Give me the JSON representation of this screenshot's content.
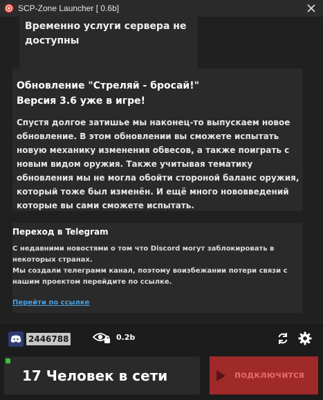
{
  "window": {
    "title": "SCP-Zone Launcher [ 0.6b]"
  },
  "news": [
    {
      "body": "Временно услуги сервера не доступны"
    },
    {
      "heading_line1": "Обновление \"Стреляй - бросай!\"",
      "heading_line2": "Версия 3.6 уже в игре!",
      "body": "Спустя долгое затишье мы наконец-то выпускаем новое обновление. В этом обновлении вы сможете испытать новую механику изменения обвесов, а также поиграть с новым видом оружия. Также учитывая тематику обновления мы не могла обойти стороной баланс оружия, который тоже был изменён. И ещё много нововведений которые вы сами сможете испытать."
    },
    {
      "heading": "Переход в Telegram",
      "body_line1": "С недавними новостями о том что Discord могут заблокировать в некоторых странах.",
      "body_line2": "Мы создали телеграмм канал, поэтому воизбежании потери связи с нашим проектом перейдите по ссылке.",
      "link": "Перейти по ссылке"
    }
  ],
  "footer": {
    "discord_count": "2446788",
    "version": "0.2b",
    "online_text": "17 Человек в сети",
    "connect_label": "подключится"
  },
  "colors": {
    "accent_red": "#a02a2a",
    "link_blue": "#4a9fe0",
    "status_green": "#3cc23c"
  },
  "icons": [
    "app-logo-icon",
    "close-icon",
    "discord-icon",
    "eye-lock-icon",
    "refresh-icon",
    "gear-icon",
    "play-icon"
  ]
}
